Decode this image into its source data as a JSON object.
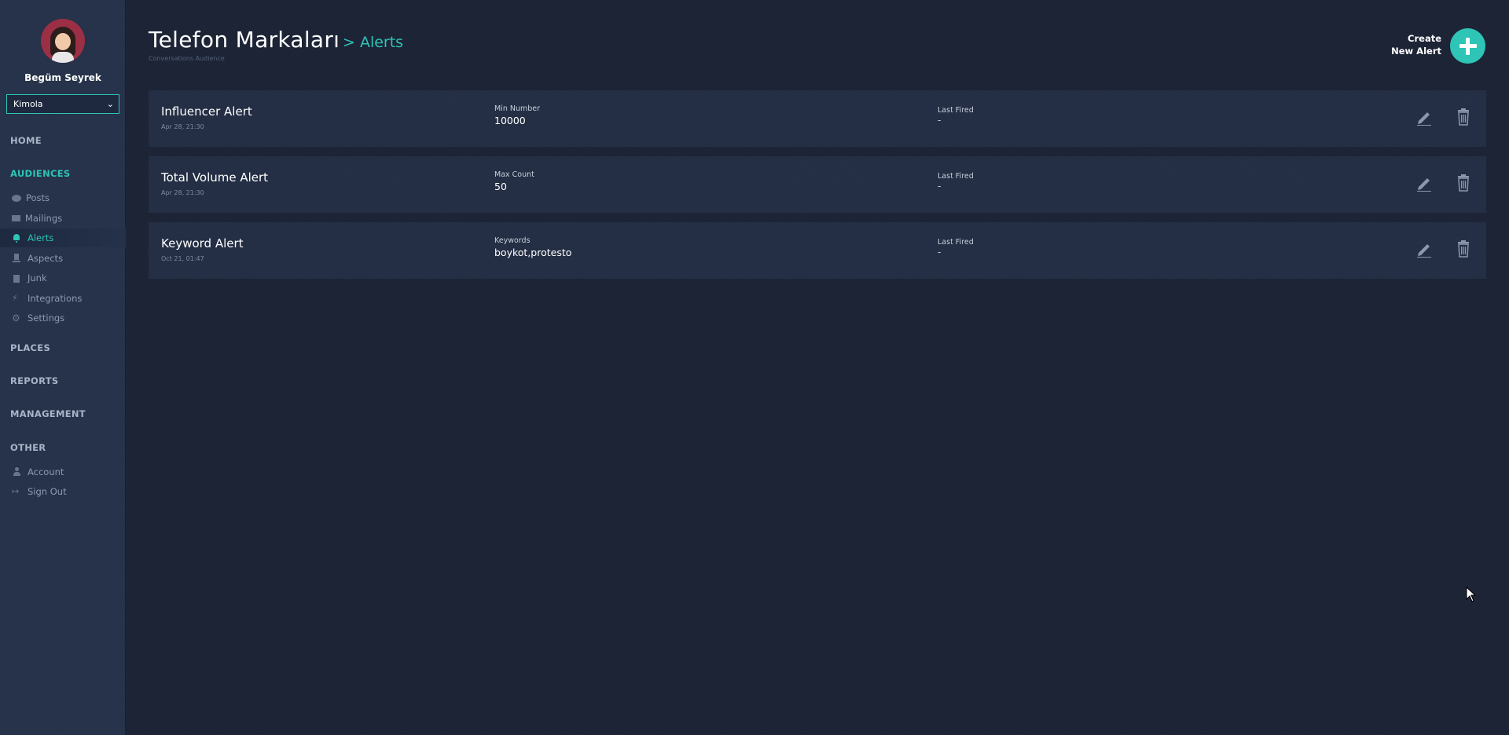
{
  "user": {
    "name": "Begüm Seyrek"
  },
  "account_select": {
    "value": "Kimola"
  },
  "nav": {
    "home": "HOME",
    "audiences": "AUDIENCES",
    "audience_items": [
      {
        "label": "Posts",
        "icon": "posts-icon"
      },
      {
        "label": "Mailings",
        "icon": "mail-icon"
      },
      {
        "label": "Alerts",
        "icon": "bell-icon"
      },
      {
        "label": "Aspects",
        "icon": "aspects-icon"
      },
      {
        "label": "Junk",
        "icon": "trash-icon"
      },
      {
        "label": "Integrations",
        "icon": "lightning-icon"
      },
      {
        "label": "Settings",
        "icon": "gear-icon"
      }
    ],
    "places": "PLACES",
    "reports": "REPORTS",
    "management": "MANAGEMENT",
    "other": "OTHER",
    "other_items": [
      {
        "label": "Account",
        "icon": "user-icon"
      },
      {
        "label": "Sign Out",
        "icon": "sign-out-icon"
      }
    ]
  },
  "header": {
    "title": "Telefon Markaları",
    "subtitle": "> Alerts",
    "caption": "Conversations Audience",
    "create_label_line1": "Create",
    "create_label_line2": "New Alert"
  },
  "alerts": [
    {
      "name": "Influencer Alert",
      "date": "Apr 28, 21:30",
      "field_label": "Min Number",
      "field_value": "10000",
      "fired_label": "Last Fired",
      "fired_value": "-"
    },
    {
      "name": "Total Volume Alert",
      "date": "Apr 28, 21:30",
      "field_label": "Max Count",
      "field_value": "50",
      "fired_label": "Last Fired",
      "fired_value": "-"
    },
    {
      "name": "Keyword Alert",
      "date": "Oct 21, 01:47",
      "field_label": "Keywords",
      "field_value": "boykot,protesto",
      "fired_label": "Last Fired",
      "fired_value": "-"
    }
  ],
  "colors": {
    "accent": "#2ec4b6",
    "background": "#1b2335",
    "sidebar": "#253249",
    "card": "#232e44"
  }
}
